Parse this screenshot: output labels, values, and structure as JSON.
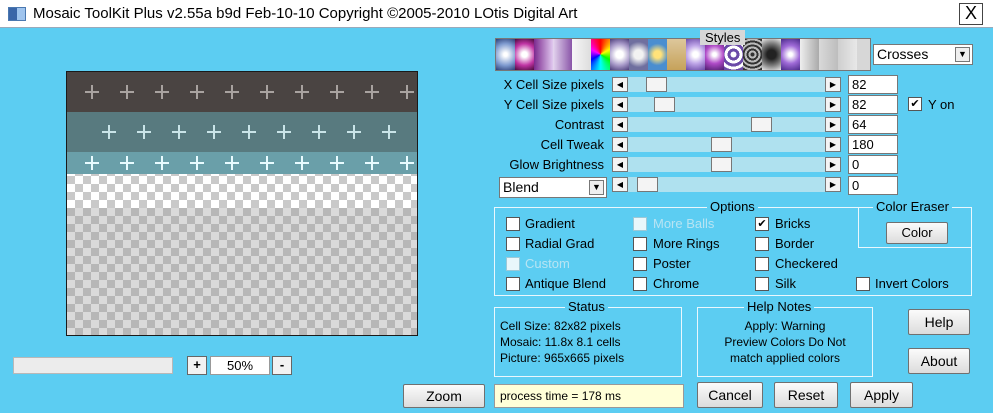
{
  "title": "Mosaic ToolKit Plus  v2.55a b9d Feb-10-10  Copyright ©2005-2010 LOtis Digital Art",
  "close_glyph": "X",
  "zoom": {
    "plus": "+",
    "value": "50%",
    "minus": "-",
    "button": "Zoom"
  },
  "styles": {
    "label": "Styles",
    "selected": "Crosses"
  },
  "sliders": [
    {
      "label": "X Cell Size pixels",
      "value": "82",
      "position": 0.1
    },
    {
      "label": "Y Cell Size pixels",
      "value": "82",
      "position": 0.15
    },
    {
      "label": "Contrast",
      "value": "64",
      "position": 0.7
    },
    {
      "label": "Cell Tweak",
      "value": "180",
      "position": 0.47
    },
    {
      "label": "Glow Brightness",
      "value": "0",
      "position": 0.47
    },
    {
      "label": "Blend",
      "value": "0",
      "position": 0.05
    }
  ],
  "y_on": {
    "label": "Y on",
    "checked": true
  },
  "options": {
    "title": "Options",
    "items": [
      {
        "label": "Gradient",
        "checked": false,
        "enabled": true
      },
      {
        "label": "Radial Grad",
        "checked": false,
        "enabled": true
      },
      {
        "label": "Custom",
        "checked": false,
        "enabled": false
      },
      {
        "label": "Antique Blend",
        "checked": false,
        "enabled": true
      },
      {
        "label": "More Balls",
        "checked": false,
        "enabled": false
      },
      {
        "label": "More Rings",
        "checked": false,
        "enabled": true
      },
      {
        "label": "Poster",
        "checked": false,
        "enabled": true
      },
      {
        "label": "Chrome",
        "checked": false,
        "enabled": true
      },
      {
        "label": "Bricks",
        "checked": true,
        "enabled": true
      },
      {
        "label": "Border",
        "checked": false,
        "enabled": true
      },
      {
        "label": "Checkered",
        "checked": false,
        "enabled": true
      },
      {
        "label": "Silk",
        "checked": false,
        "enabled": true
      },
      {
        "label": "Invert Colors",
        "checked": false,
        "enabled": true
      }
    ]
  },
  "color_eraser": {
    "title": "Color Eraser",
    "button": "Color"
  },
  "status": {
    "title": "Status",
    "lines": [
      "Cell Size: 82x82 pixels",
      "Mosaic:  11.8x  8.1 cells",
      "Picture: 965x665 pixels"
    ]
  },
  "help_notes": {
    "title": "Help Notes",
    "lines": [
      "Apply: Warning",
      "Preview Colors Do Not",
      "match applied colors"
    ]
  },
  "buttons": {
    "help": "Help",
    "about": "About",
    "cancel": "Cancel",
    "reset": "Reset",
    "apply": "Apply"
  },
  "process_time": "process time = 178 ms"
}
